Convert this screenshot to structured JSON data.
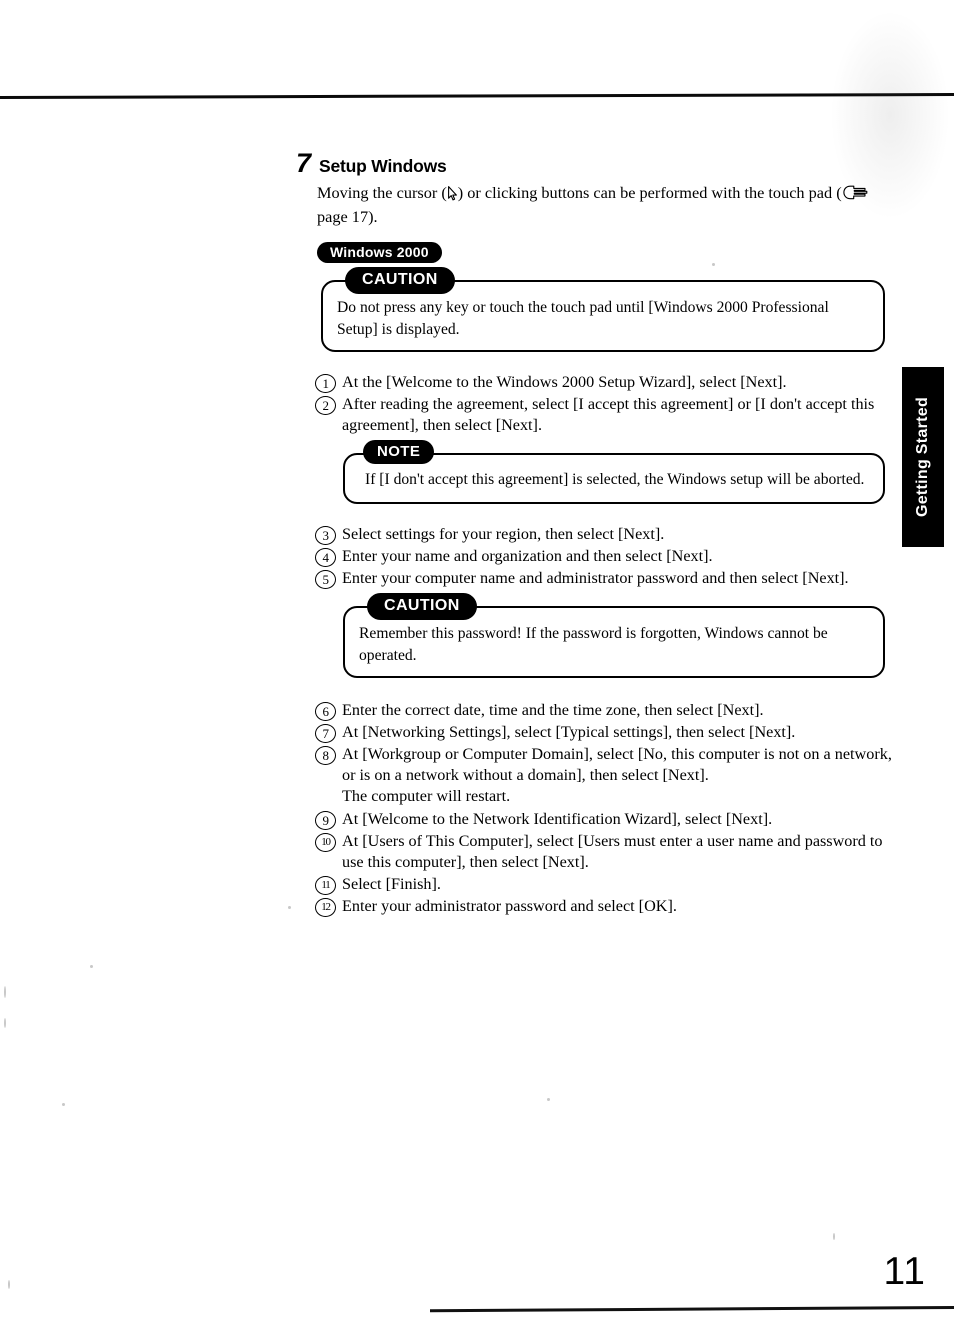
{
  "document": {
    "page_number": "11",
    "side_tab_label": "Getting Started"
  },
  "section": {
    "number": "7",
    "title": "Setup Windows",
    "intro_before_cursor": "Moving the cursor (",
    "intro_after_cursor": ") or clicking buttons can be performed with the touch pad (",
    "intro_after_hand": " page 17).",
    "os_badge": "Windows 2000"
  },
  "callouts": {
    "caution_1": {
      "tag": "CAUTION",
      "body": "Do not press any key or touch the touch pad until [Windows 2000 Professional Setup] is displayed."
    },
    "note_1": {
      "tag": "NOTE",
      "body": "If [I don't accept this agreement] is selected, the Windows setup will be aborted."
    },
    "caution_2": {
      "tag": "CAUTION",
      "body": "Remember this password!  If the password is forgotten, Windows cannot be operated."
    }
  },
  "steps_group_a": [
    {
      "num": "1",
      "text": "At the [Welcome to the Windows 2000 Setup Wizard], select [Next]."
    },
    {
      "num": "2",
      "text": "After reading the agreement, select [I accept this agreement] or [I don't accept this agreement], then select [Next]."
    }
  ],
  "steps_group_b": [
    {
      "num": "3",
      "text": "Select settings for your region, then select [Next]."
    },
    {
      "num": "4",
      "text": "Enter your name and organization and then select [Next]."
    },
    {
      "num": "5",
      "text": "Enter your computer name and administrator password and then select [Next]."
    }
  ],
  "steps_group_c": [
    {
      "num": "6",
      "text": "Enter the correct date, time and the time zone, then select [Next].",
      "cont": ""
    },
    {
      "num": "7",
      "text": "At [Networking Settings], select [Typical settings], then select [Next].",
      "cont": ""
    },
    {
      "num": "8",
      "text": "At [Workgroup or Computer Domain], select [No, this computer is not on a network, or is on a network without a domain], then select [Next].",
      "cont": "The computer will restart."
    },
    {
      "num": "9",
      "text": "At [Welcome to the Network Identification Wizard], select [Next].",
      "cont": ""
    },
    {
      "num": "10",
      "text": "At [Users of This Computer], select [Users must enter a user name and password to use this computer], then select [Next].",
      "cont": ""
    },
    {
      "num": "11",
      "text": "Select [Finish].",
      "cont": ""
    },
    {
      "num": "12",
      "text": "Enter your administrator password and select [OK].",
      "cont": ""
    }
  ],
  "icons": {
    "cursor": "mouse-pointer-icon",
    "hand": "pointing-hand-icon"
  },
  "colors": {
    "ink": "#000000",
    "paper": "#ffffff"
  }
}
